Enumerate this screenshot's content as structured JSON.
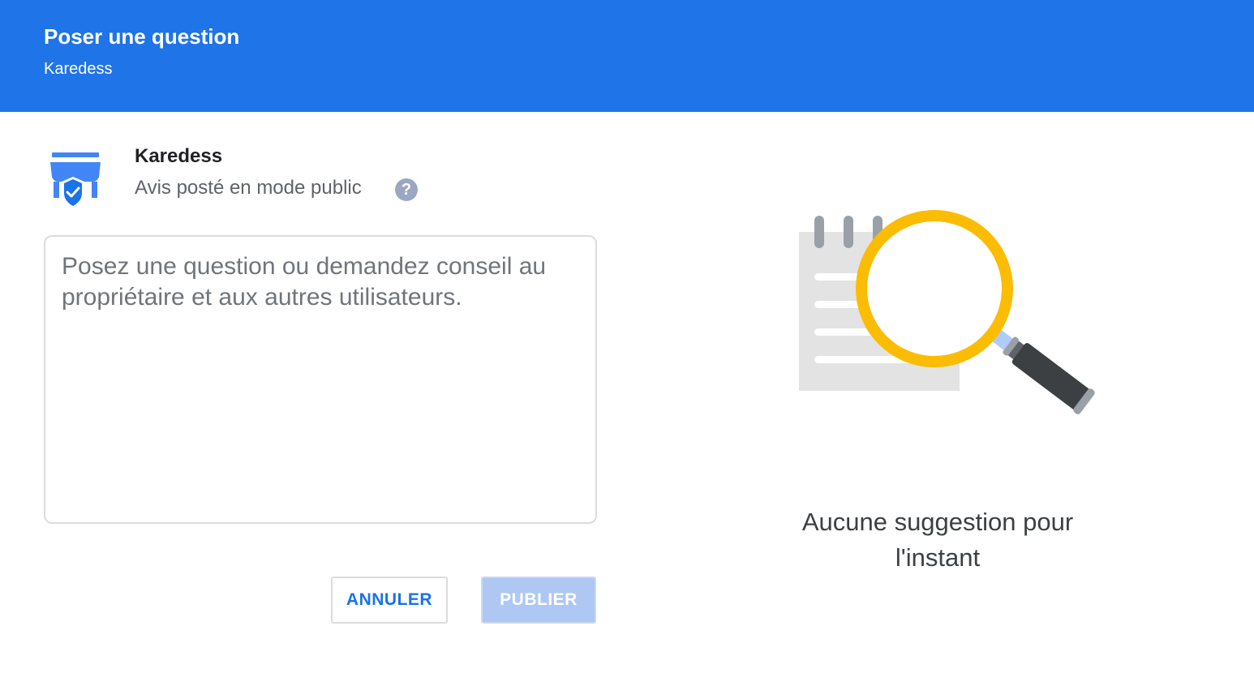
{
  "header": {
    "title": "Poser une question",
    "subtitle": "Karedess"
  },
  "business": {
    "icon": "verified-storefront-icon",
    "name": "Karedess",
    "visibility": "Avis posté en mode public",
    "help_icon": "help-circle-icon"
  },
  "question": {
    "value": "",
    "placeholder": "Posez une question ou demandez conseil au propriétaire et aux autres utilisateurs."
  },
  "actions": {
    "cancel_label": "ANNULER",
    "publish_label": "PUBLIER",
    "publish_enabled": false
  },
  "suggestions": {
    "illustration": "notepad-magnifier-illustration",
    "empty_message": "Aucune suggestion pour l'instant"
  },
  "colors": {
    "header_bg": "#1f74e8",
    "accent": "#1a73e8",
    "publish_disabled_bg": "#aec8f3",
    "magnifier_ring": "#fbbc04"
  }
}
